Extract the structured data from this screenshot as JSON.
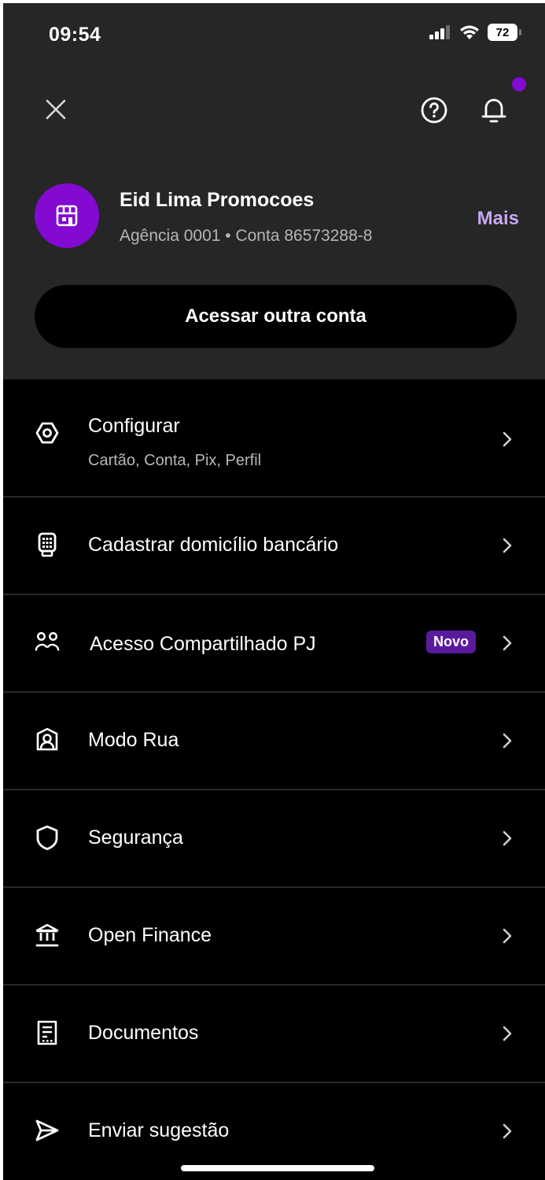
{
  "status_bar": {
    "time": "09:54",
    "battery": "72",
    "icons": [
      "signal-icon",
      "wifi-icon",
      "battery-icon"
    ]
  },
  "header": {
    "icons": [
      "close-icon",
      "help-icon",
      "bell-icon"
    ],
    "accent": "#820ad1"
  },
  "account": {
    "name": "Eid Lima Promocoes",
    "details": "Agência 0001 • Conta 86573288-8",
    "more_label": "Mais",
    "avatar_icon": "store-icon"
  },
  "switch_account_label": "Acessar outra conta",
  "menu": {
    "items": [
      {
        "label": "Configurar",
        "sublabel": "Cartão, Conta, Pix, Perfil",
        "icon": "settings-hex-icon"
      },
      {
        "label": "Cadastrar domicílio bancário",
        "icon": "pos-terminal-icon"
      },
      {
        "label": "Acesso Compartilhado PJ",
        "badge": "Novo",
        "icon": "people-icon"
      },
      {
        "label": "Modo Rua",
        "icon": "portrait-icon"
      },
      {
        "label": "Segurança",
        "icon": "shield-icon"
      },
      {
        "label": "Open Finance",
        "icon": "bank-icon"
      },
      {
        "label": "Documentos",
        "icon": "document-icon"
      },
      {
        "label": "Enviar sugestão",
        "icon": "send-icon"
      }
    ]
  }
}
